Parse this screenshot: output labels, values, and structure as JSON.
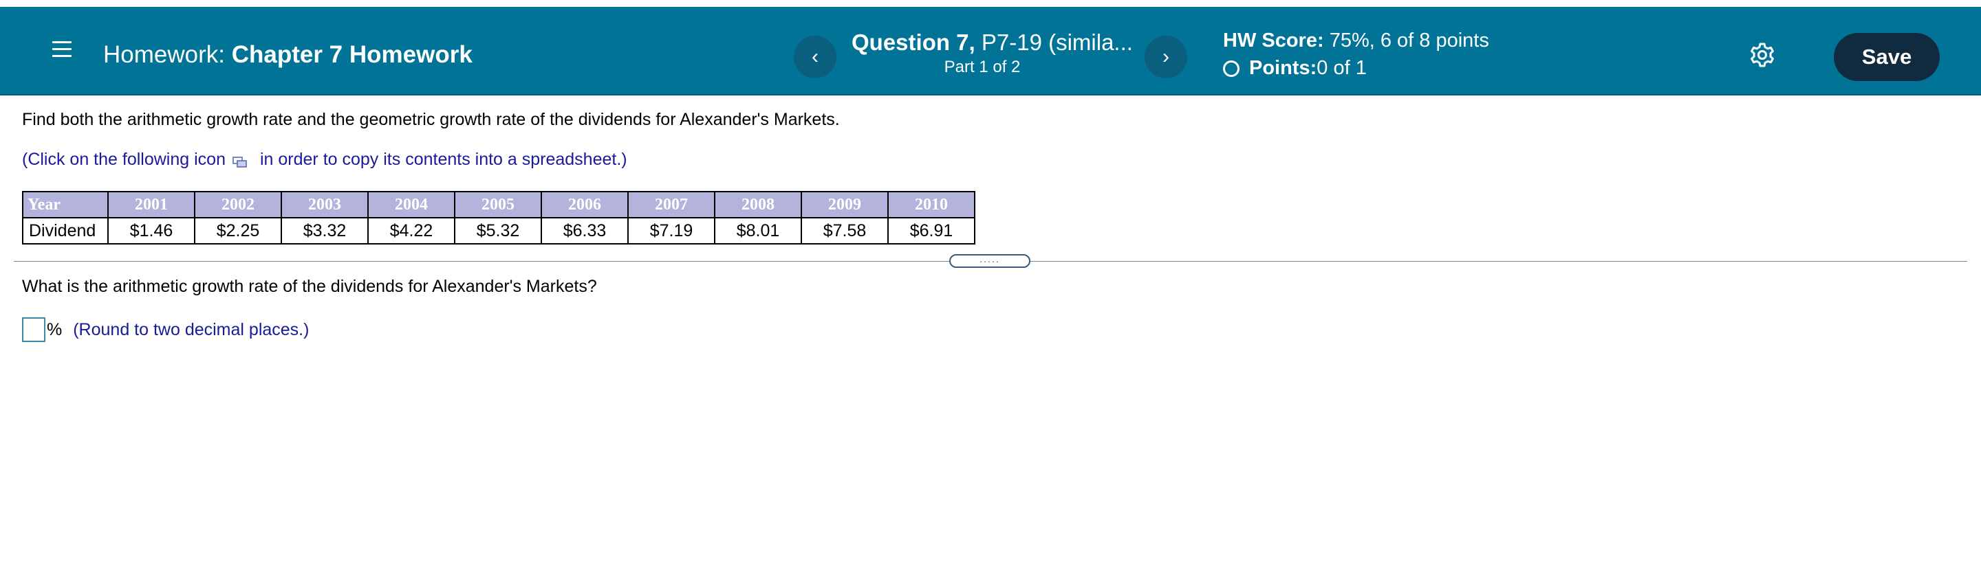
{
  "header": {
    "hw_prefix": "Homework:",
    "hw_name": "Chapter 7 Homework",
    "question_label": "Question 7,",
    "question_name": " P7-19 (simila...",
    "part": "Part 1 of 2",
    "prev_glyph": "‹",
    "next_glyph": "›",
    "score_label": "HW Score:",
    "score_value": " 75%, 6 of 8 points",
    "points_label": "Points:",
    "points_value": " 0 of 1",
    "save_label": "Save",
    "bg_color": "#007396",
    "save_color": "#102a40"
  },
  "content": {
    "prompt": "Find both the arithmetic growth rate and the geometric growth rate of the dividends for Alexander's Markets.",
    "click_before": "(Click on the following icon",
    "click_after": "in order to copy its contents into a spreadsheet.)",
    "table": {
      "headers": [
        "Year",
        "2001",
        "2002",
        "2003",
        "2004",
        "2005",
        "2006",
        "2007",
        "2008",
        "2009",
        "2010"
      ],
      "row": [
        "Dividend",
        "$1.46",
        "$2.25",
        "$3.32",
        "$4.22",
        "$5.32",
        "$6.33",
        "$7.19",
        "$8.01",
        "$7.58",
        "$6.91"
      ]
    },
    "handle_dots": ".....",
    "question": "What is the arithmetic growth rate of the dividends for Alexander's Markets?",
    "answer_value": "",
    "percent": "%",
    "round_note": "(Round to two decimal places.)"
  }
}
